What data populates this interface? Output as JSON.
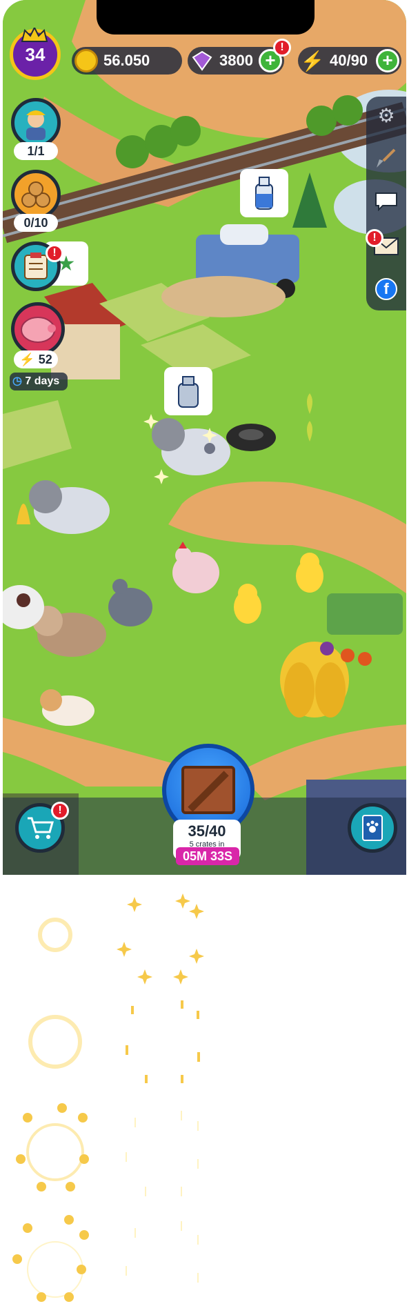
{
  "hud": {
    "level": "34",
    "coins": "56.050",
    "gems": "3800",
    "energy": "40/90",
    "plus_label": "+",
    "alert_label": "!"
  },
  "left_panel": {
    "farmer_count": "1/1",
    "wood_count": "0/10",
    "piggy_energy": "52",
    "piggy_days": "7 days"
  },
  "crate": {
    "count": "35/40",
    "subtitle": "5 crates in",
    "timer": "05M 33S"
  },
  "icons": {
    "coin": "coin-icon",
    "gem": "gem-icon",
    "energy": "lightning-icon",
    "settings": "gear-icon",
    "shovel": "shovel-icon",
    "chat": "chat-icon",
    "mail": "mail-icon",
    "facebook": "facebook-icon",
    "shop": "shopping-cart-icon",
    "book": "paw-book-icon"
  },
  "colors": {
    "grass": "#7ec63e",
    "hud_bg": "#1e283c",
    "plus_green": "#3fb43a",
    "alert_red": "#e11d2a",
    "level_purple": "#6b21a8",
    "timer_magenta": "#d926a9",
    "crate_blue": "#1565d8"
  }
}
